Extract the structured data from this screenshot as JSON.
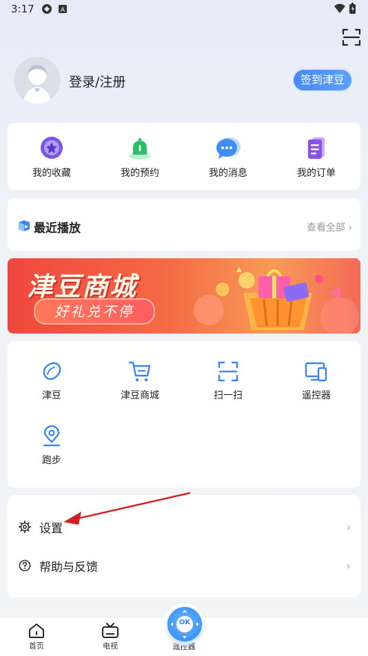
{
  "status_bar": {
    "time": "3:17"
  },
  "profile": {
    "login_label": "登录/注册",
    "sign_in_button": "签到津豆"
  },
  "quick_links": [
    {
      "label": "我的收藏",
      "icon": "favorites-icon"
    },
    {
      "label": "我的预约",
      "icon": "reservation-bell-icon"
    },
    {
      "label": "我的消息",
      "icon": "message-icon"
    },
    {
      "label": "我的订单",
      "icon": "order-icon"
    }
  ],
  "recent": {
    "title": "最近播放",
    "more": "查看全部"
  },
  "banner": {
    "title": "津豆商城",
    "subtitle": "好礼兑不停"
  },
  "tools": [
    {
      "label": "津豆",
      "icon": "bean-icon"
    },
    {
      "label": "津豆商城",
      "icon": "cart-icon"
    },
    {
      "label": "扫一扫",
      "icon": "scan-icon"
    },
    {
      "label": "遥控器",
      "icon": "remote-devices-icon"
    },
    {
      "label": "跑步",
      "icon": "location-run-icon"
    }
  ],
  "settings": [
    {
      "label": "设置",
      "icon": "gear-icon"
    },
    {
      "label": "帮助与反馈",
      "icon": "help-icon"
    }
  ],
  "tabbar": {
    "home": "首页",
    "tv": "电视",
    "remote": "遥控器",
    "remote_button": "OK"
  },
  "colors": {
    "accent": "#3b8cf2",
    "banner": "#f0473f",
    "annotation_arrow": "#d42020"
  }
}
